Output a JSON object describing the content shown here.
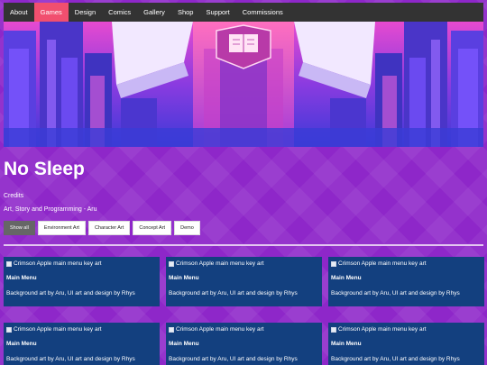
{
  "nav": {
    "items": [
      {
        "label": "About"
      },
      {
        "label": "Games"
      },
      {
        "label": "Design"
      },
      {
        "label": "Comics"
      },
      {
        "label": "Gallery"
      },
      {
        "label": "Shop"
      },
      {
        "label": "Support"
      },
      {
        "label": "Commissions"
      }
    ],
    "active": "Games"
  },
  "page": {
    "title": "No Sleep",
    "credits_label": "Credits",
    "credits_text": "Art, Story and Programming - Aru"
  },
  "filters": [
    {
      "label": "Show all",
      "active": true
    },
    {
      "label": "Environment Art",
      "active": false
    },
    {
      "label": "Character Art",
      "active": false
    },
    {
      "label": "Concept Art",
      "active": false
    },
    {
      "label": "Demo",
      "active": false
    }
  ],
  "cards": [
    {
      "img_alt": "Crimson Apple main menu key art",
      "title": "Main Menu",
      "description": "Background art by Aru, UI art and design by Rhys"
    },
    {
      "img_alt": "Crimson Apple main menu key art",
      "title": "Main Menu",
      "description": "Background art by Aru, UI art and design by Rhys"
    },
    {
      "img_alt": "Crimson Apple main menu key art",
      "title": "Main Menu",
      "description": "Background art by Aru, UI art and design by Rhys"
    },
    {
      "img_alt": "Crimson Apple main menu key art",
      "title": "Main Menu",
      "description": "Background art by Aru, UI art and design by Rhys"
    },
    {
      "img_alt": "Crimson Apple main menu key art",
      "title": "Main Menu",
      "description": "Background art by Aru, UI art and design by Rhys"
    },
    {
      "img_alt": "Crimson Apple main menu key art",
      "title": "Main Menu",
      "description": "Background art by Aru, UI art and design by Rhys"
    }
  ],
  "colors": {
    "page_bg": "#8e27c9",
    "nav_bg": "#333333",
    "nav_active": "#f14f6f",
    "card_bg": "#13407f",
    "filter_active": "#666666"
  },
  "icons": {
    "broken_image": "broken-image-icon",
    "hero_emblem": "book-emblem-icon"
  }
}
